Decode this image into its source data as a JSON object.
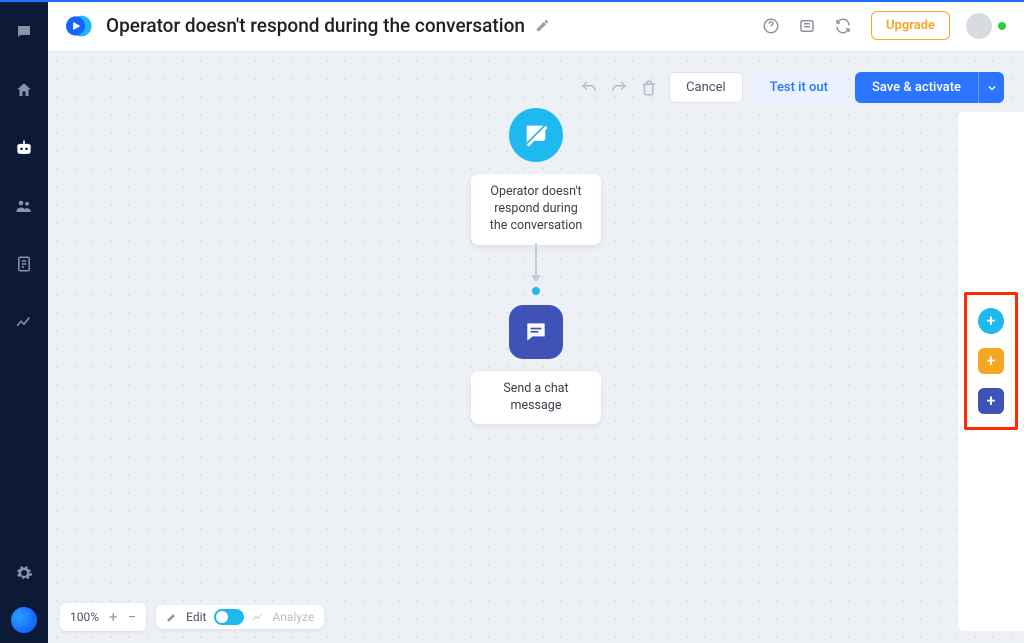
{
  "header": {
    "title": "Operator doesn't respond during the conversation",
    "upgrade_label": "Upgrade"
  },
  "actions": {
    "cancel": "Cancel",
    "test": "Test it out",
    "save": "Save & activate"
  },
  "flow": {
    "trigger_label": "Operator doesn't respond during the conversation",
    "action_label": "Send a chat message"
  },
  "zoom": {
    "level": "100%"
  },
  "mode": {
    "edit": "Edit",
    "analyze": "Analyze"
  },
  "palette": {
    "plus": "+"
  }
}
